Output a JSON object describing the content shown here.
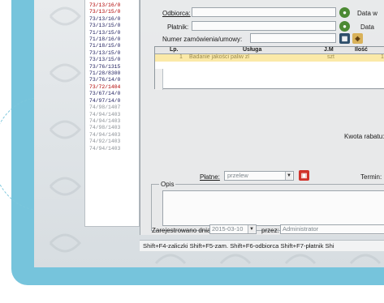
{
  "left_list": {
    "rows": [
      {
        "text": "73/13/16/0",
        "color": "#b00000"
      },
      {
        "text": "73/13/15/0",
        "color": "#b00000"
      },
      {
        "text": "73/13/16/0",
        "color": "#1a1a5a"
      },
      {
        "text": "73/13/15/0",
        "color": "#1a1a5a"
      },
      {
        "text": "71/13/15/0",
        "color": "#1a1a5a"
      },
      {
        "text": "71/18/16/0",
        "color": "#1a1a5a"
      },
      {
        "text": "71/18/15/0",
        "color": "#1a1a5a"
      },
      {
        "text": "73/13/15/0",
        "color": "#1a1a5a"
      },
      {
        "text": "73/13/15/0",
        "color": "#1a1a5a"
      },
      {
        "text": "73/76/1315",
        "color": "#1a1a5a"
      },
      {
        "text": "71/28/8300",
        "color": "#1a1a5a"
      },
      {
        "text": "73/76/14/0",
        "color": "#1a1a5a"
      },
      {
        "text": "73/72/1404",
        "color": "#b00000"
      },
      {
        "text": "73/67/14/0",
        "color": "#1a1a5a"
      },
      {
        "text": "74/97/14/0",
        "color": "#1a1a5a"
      },
      {
        "text": "74/98/1407",
        "color": "#8a8f95"
      },
      {
        "text": "74/94/1403",
        "color": "#8a8f95"
      },
      {
        "text": "74/94/1403",
        "color": "#8a8f95"
      },
      {
        "text": "74/98/1403",
        "color": "#8a8f95"
      },
      {
        "text": "74/94/1403",
        "color": "#8a8f95"
      },
      {
        "text": "74/92/1403",
        "color": "#8a8f95"
      },
      {
        "text": "74/94/1403",
        "color": "#8a8f95"
      }
    ]
  },
  "header": {
    "odbiorca_label": "Odbiorca:",
    "platnik_label": "Płatnik:",
    "numer_label": "Numer zamówienia/umowy:",
    "data_w_label": "Data w",
    "data_label": "Data"
  },
  "grid": {
    "columns": [
      "Lp.",
      "Usługa",
      "J.M",
      "Ilość"
    ],
    "rows": [
      {
        "lp": "1",
        "usluga": "Badanie jakości paliw zl",
        "jm": "szt",
        "ilosc": "1"
      }
    ]
  },
  "rabat": {
    "label": "Kwota rabatu:"
  },
  "platne": {
    "label": "Płatne:",
    "value": "przelew",
    "termin_label": "Termin:"
  },
  "opis": {
    "label": "Opis"
  },
  "registration": {
    "label": "Zarejestrowano dnia:",
    "date": "2015-03-10",
    "by_label": "przez:",
    "by_value": "Administrator"
  },
  "status_bar": {
    "text": "Shift+F4-zaliczki Shift+F5-zam. Shift+F6-odbiorca Shift+F7-płatnik Shi"
  },
  "colors": {
    "panel": "#76c4dc",
    "selected_row": "#fbe9a8",
    "ok_button": "#4c8a33",
    "delete_button": "#d0322b"
  }
}
